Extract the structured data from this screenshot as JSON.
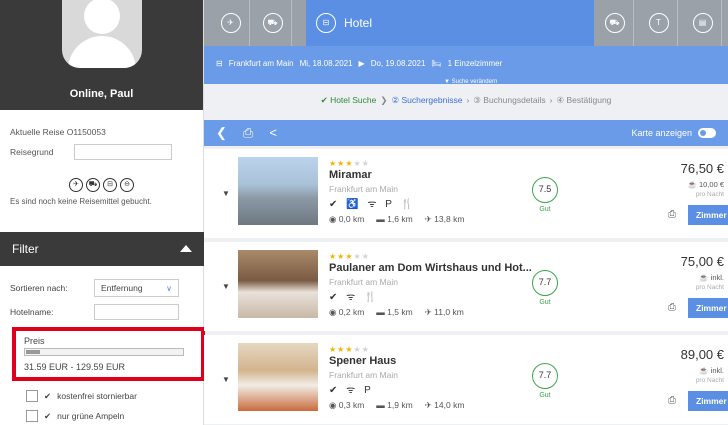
{
  "profile": {
    "name": "Online, Paul"
  },
  "trip": {
    "current_label": "Aktuelle Reise",
    "current_value": "O1150053",
    "reason_label": "Reisegrund"
  },
  "travel_means": {
    "empty_text": "Es sind noch keine Reisemittel gebucht."
  },
  "filter": {
    "title": "Filter",
    "sort_label": "Sortieren nach:",
    "sort_value": "Entfernung",
    "hotel_name_label": "Hotelname:",
    "price_label": "Preis",
    "price_range": "31.59 EUR - 129.59 EUR",
    "checkbox_free_cancel": "kostenfrei stornierbar",
    "checkbox_green": "nur grüne Ampeln"
  },
  "tabs": {
    "active_label": "Hotel"
  },
  "search": {
    "city": "Frankfurt am Main",
    "date_from": "Mi, 18.08.2021",
    "date_to": "Do, 19.08.2021",
    "rooms": "1 Einzelzimmer",
    "change_link": "▼ Suche verändern"
  },
  "steps": {
    "step1": "Hotel Suche",
    "step2": "Suchergebnisse",
    "step3": "Buchungsdetails",
    "step4": "Bestätigung"
  },
  "toolbar": {
    "map_label": "Karte anzeigen"
  },
  "hotels": [
    {
      "name": "Miramar",
      "city": "Frankfurt am Main",
      "score": "7.5",
      "score_label": "Gut",
      "dist_center": "0,0 km",
      "dist_train": "1,6 km",
      "dist_air": "13,8 km",
      "price": "76,50 €",
      "sub": "10,00 €",
      "per_night": "pro Nacht",
      "button": "Zimmer",
      "amenities": "✔ ♿ ᯤ P 🍴"
    },
    {
      "name": "Paulaner am Dom Wirtshaus und Hot...",
      "city": "Frankfurt am Main",
      "score": "7.7",
      "score_label": "Gut",
      "dist_center": "0,2 km",
      "dist_train": "1,5 km",
      "dist_air": "11,0 km",
      "price": "75,00 €",
      "sub": "inkl.",
      "per_night": "pro Nacht",
      "button": "Zimmer",
      "amenities": "✔ ᯤ 🍴"
    },
    {
      "name": "Spener Haus",
      "city": "Frankfurt am Main",
      "score": "7.7",
      "score_label": "Gut",
      "dist_center": "0,3 km",
      "dist_train": "1,9 km",
      "dist_air": "14,0 km",
      "price": "89,00 €",
      "sub": "inkl.",
      "per_night": "pro Nacht",
      "button": "Zimmer",
      "amenities": "✔ ᯤ P"
    }
  ],
  "colors": {
    "accent": "#5b8fe3",
    "highlight": "#e0001b",
    "score": "#3aa64a"
  }
}
